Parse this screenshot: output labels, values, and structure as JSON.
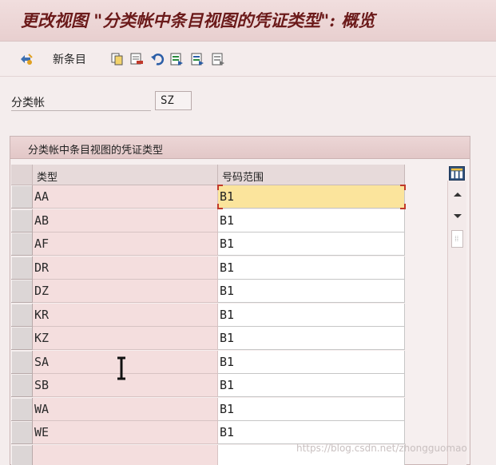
{
  "window": {
    "title": "更改视图 \"分类帐中条目视图的凭证类型\": 概览"
  },
  "toolbar": {
    "new_entries_label": "新条目",
    "icons": [
      "display-change-icon",
      "copy-icon",
      "delete-icon",
      "undo-icon",
      "select-all-icon",
      "select-block-icon",
      "deselect-all-icon"
    ]
  },
  "field": {
    "label": "分类帐",
    "value": "SZ"
  },
  "group": {
    "title": "分类帐中条目视图的凭证类型"
  },
  "table": {
    "headers": [
      "类型",
      "号码范围"
    ],
    "rows": [
      {
        "type": "AA",
        "number_range": "B1"
      },
      {
        "type": "AB",
        "number_range": "B1"
      },
      {
        "type": "AF",
        "number_range": "B1"
      },
      {
        "type": "DR",
        "number_range": "B1"
      },
      {
        "type": "DZ",
        "number_range": "B1"
      },
      {
        "type": "KR",
        "number_range": "B1"
      },
      {
        "type": "KZ",
        "number_range": "B1"
      },
      {
        "type": "SA",
        "number_range": "B1"
      },
      {
        "type": "SB",
        "number_range": "B1"
      },
      {
        "type": "WA",
        "number_range": "B1"
      },
      {
        "type": "WE",
        "number_range": "B1"
      },
      {
        "type": "",
        "number_range": ""
      }
    ],
    "focused_row": 0
  },
  "watermark": "https://blog.csdn.net/zhongguomao",
  "colors": {
    "title_text": "#6b1a1a",
    "key_column_bg": "#f4dede",
    "focused_cell_bg": "#fbe49c"
  }
}
